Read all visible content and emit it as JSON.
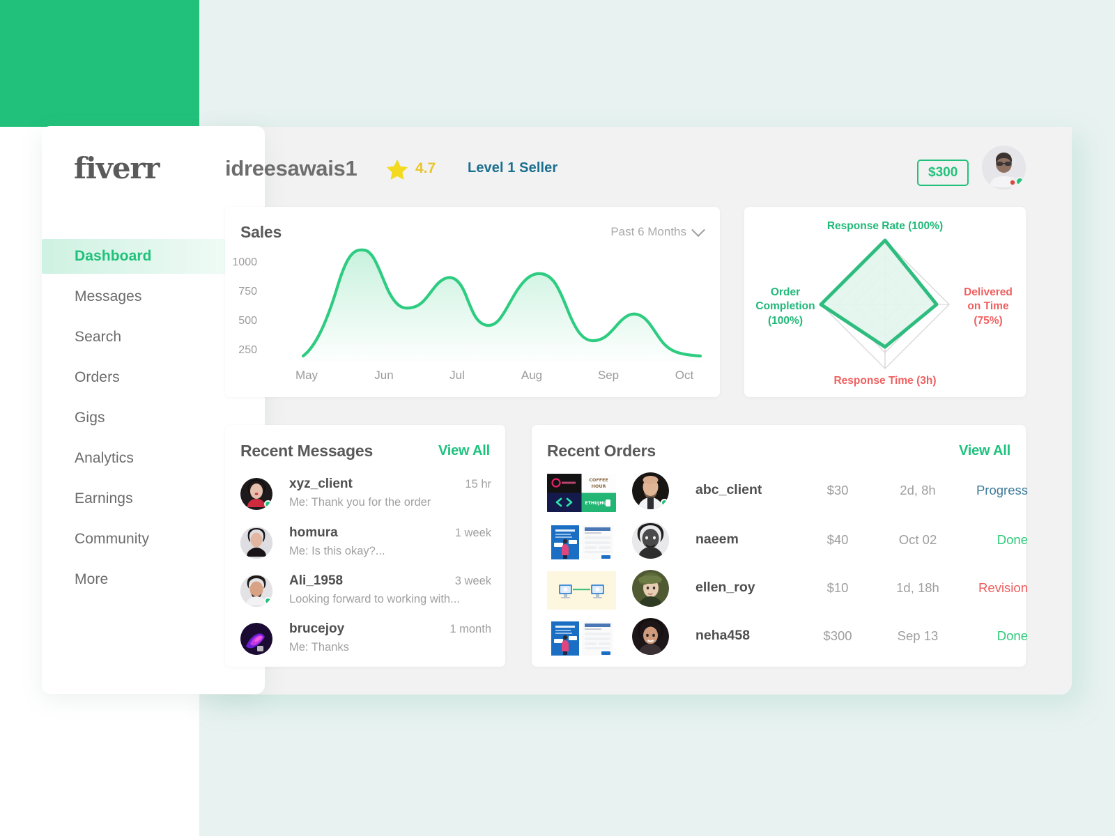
{
  "brand": {
    "logo_text": "fiverr",
    "accent": "#22c17b"
  },
  "sidebar": {
    "items": [
      {
        "label": "Dashboard",
        "active": true
      },
      {
        "label": "Messages",
        "active": false
      },
      {
        "label": "Search",
        "active": false
      },
      {
        "label": "Orders",
        "active": false
      },
      {
        "label": "Gigs",
        "active": false
      },
      {
        "label": "Analytics",
        "active": false
      },
      {
        "label": "Earnings",
        "active": false
      },
      {
        "label": "Community",
        "active": false
      },
      {
        "label": "More",
        "active": false
      }
    ]
  },
  "header": {
    "username": "idreesawais1",
    "rating": "4.7",
    "rating_color": "#e6c52f",
    "level": "Level 1 Seller",
    "level_color": "#1b6f8f",
    "balance": "$300",
    "balance_color": "#22c17b",
    "avatar_status": "online"
  },
  "sales_card": {
    "title": "Sales",
    "range_label": "Past 6 Months"
  },
  "radar_card": {
    "labels": {
      "top": "Response Rate (100%)",
      "right_line1": "Delivered",
      "right_line2": "on Time",
      "right_line3": "(75%)",
      "bottom": "Response Time (3h)",
      "left_line1": "Order",
      "left_line2": "Completion",
      "left_line3": "(100%)"
    }
  },
  "messages_card": {
    "title": "Recent Messages",
    "view_all": "View All",
    "rows": [
      {
        "name": "xyz_client",
        "preview": "Me: Thank you for the order",
        "time": "15 hr",
        "online": true
      },
      {
        "name": "homura",
        "preview": "Me: Is this okay?...",
        "time": "1 week",
        "online": false
      },
      {
        "name": "Ali_1958",
        "preview": "Looking forward to working with...",
        "time": "3 week",
        "online": true
      },
      {
        "name": "brucejoy",
        "preview": "Me: Thanks",
        "time": "1 month",
        "online": false
      }
    ]
  },
  "orders_card": {
    "title": "Recent Orders",
    "view_all": "View All",
    "rows": [
      {
        "client": "abc_client",
        "price": "$30",
        "date": "2d, 8h",
        "status": "Progress",
        "status_color": "#3d7a99",
        "online": true,
        "thumb": "logo-grid"
      },
      {
        "client": "naeem",
        "price": "$40",
        "date": "Oct 02",
        "status": "Done",
        "status_color": "#2ec97a",
        "online": false,
        "thumb": "landing-page"
      },
      {
        "client": "ellen_roy",
        "price": "$10",
        "date": "1d, 18h",
        "status": "Revision",
        "status_color": "#ef5b5b",
        "online": false,
        "thumb": "monitors"
      },
      {
        "client": "neha458",
        "price": "$300",
        "date": "Sep 13",
        "status": "Done",
        "status_color": "#2ec97a",
        "online": false,
        "thumb": "landing-page"
      }
    ]
  },
  "chart_data": [
    {
      "type": "area",
      "title": "Sales",
      "xlabel": "",
      "ylabel": "",
      "categories": [
        "May",
        "Jun",
        "Jul",
        "Aug",
        "Sep",
        "Oct"
      ],
      "x_tick_labels": [
        "May",
        "Jun",
        "Jul",
        "Aug",
        "Sep",
        "Oct"
      ],
      "y_tick_labels": [
        "1000",
        "750",
        "500",
        "250"
      ],
      "ylim": [
        0,
        1100
      ],
      "grid": false,
      "legend": "none",
      "series": [
        {
          "name": "Sales",
          "color": "#2ecc80",
          "values": [
            260,
            1000,
            670,
            790,
            530,
            860,
            400,
            550,
            275
          ],
          "x_positions": [
            0.0,
            0.18,
            0.33,
            0.47,
            0.58,
            0.72,
            0.83,
            0.9,
            1.0
          ]
        }
      ]
    },
    {
      "type": "radar",
      "title": "",
      "axes": [
        {
          "label": "Response Rate (100%)",
          "value": 100,
          "max": 100,
          "color": "#1fb877"
        },
        {
          "label": "Delivered on Time (75%)",
          "value": 80,
          "max": 100,
          "color": "#ef5f5f"
        },
        {
          "label": "Response Time (3h)",
          "value": 75,
          "max": 100,
          "color": "#ef5f5f"
        },
        {
          "label": "Order Completion (100%)",
          "value": 100,
          "max": 100,
          "color": "#1fb877"
        }
      ],
      "rings": 4,
      "fill": "#e2f5ec",
      "stroke": "#2ebd7e",
      "grid": true,
      "legend": "none"
    }
  ]
}
